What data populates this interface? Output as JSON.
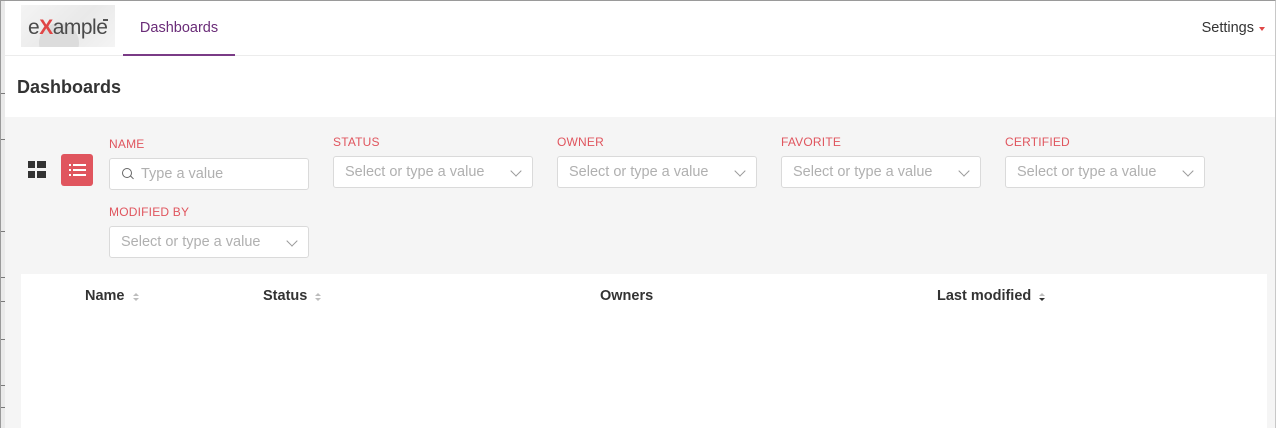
{
  "header": {
    "logo_text_pre": "e",
    "logo_text_x": "X",
    "logo_text_post": "ample",
    "nav_tab": "Dashboards",
    "settings_label": "Settings"
  },
  "page": {
    "title": "Dashboards"
  },
  "filters": {
    "name": {
      "label": "NAME",
      "placeholder": "Type a value",
      "value": ""
    },
    "status": {
      "label": "STATUS",
      "placeholder": "Select or type a value"
    },
    "owner": {
      "label": "OWNER",
      "placeholder": "Select or type a value"
    },
    "favorite": {
      "label": "FAVORITE",
      "placeholder": "Select or type a value"
    },
    "certified": {
      "label": "CERTIFIED",
      "placeholder": "Select or type a value"
    },
    "modified_by": {
      "label": "MODIFIED BY",
      "placeholder": "Select or type a value"
    }
  },
  "view_modes": {
    "active": "list"
  },
  "table": {
    "columns": [
      {
        "label": "Name",
        "sortable": true,
        "sort": "none"
      },
      {
        "label": "Status",
        "sortable": true,
        "sort": "none"
      },
      {
        "label": "Owners",
        "sortable": false,
        "sort": "none"
      },
      {
        "label": "Last modified",
        "sortable": true,
        "sort": "desc"
      }
    ]
  },
  "colors": {
    "brand_purple": "#7a3b86",
    "accent_red": "#e0555e",
    "filter_bg": "#f5f5f5"
  }
}
